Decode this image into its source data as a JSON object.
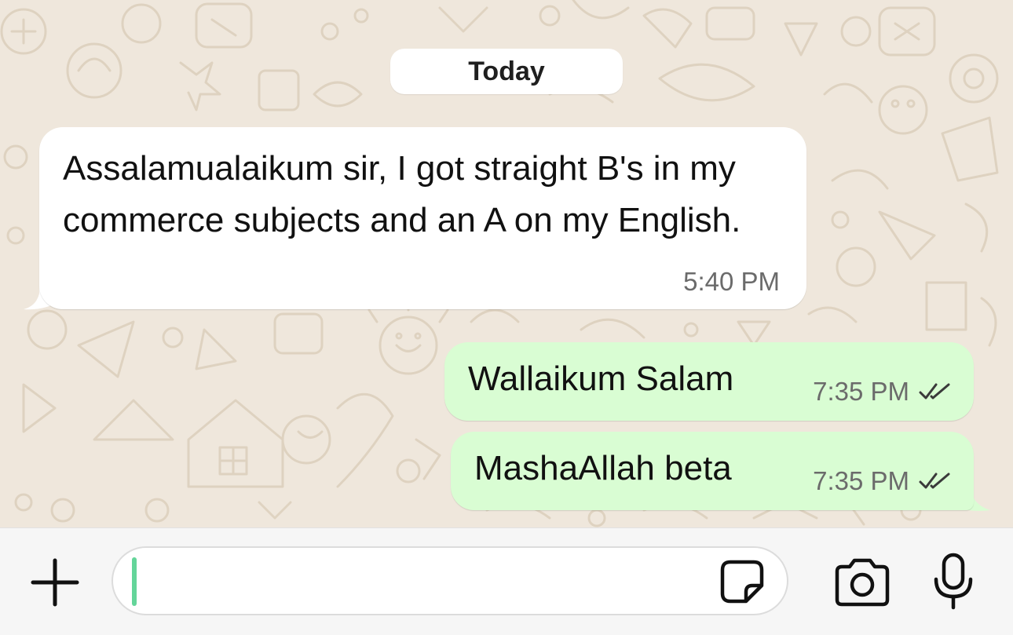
{
  "theme": {
    "chat_background": "#efe7dc",
    "incoming_bubble": "#ffffff",
    "outgoing_bubble": "#d9fdd3",
    "caret_color": "#64d59a",
    "read_ticks_color": "#3a3a3a"
  },
  "chat": {
    "date_separator": "Today",
    "messages": [
      {
        "direction": "incoming",
        "text": "Assalamualaikum sir, I got straight B's in my commerce subjects and an A on my English.",
        "time": "5:40 PM"
      },
      {
        "direction": "outgoing",
        "text": "Wallaikum Salam",
        "time": "7:35 PM",
        "status_icon": "double-check-icon"
      },
      {
        "direction": "outgoing",
        "text": "MashaAllah beta",
        "time": "7:35 PM",
        "status_icon": "double-check-icon"
      }
    ]
  },
  "composer": {
    "attach_icon": "plus-icon",
    "input_value": "",
    "sticker_icon": "sticker-icon",
    "camera_icon": "camera-icon",
    "mic_icon": "microphone-icon"
  }
}
